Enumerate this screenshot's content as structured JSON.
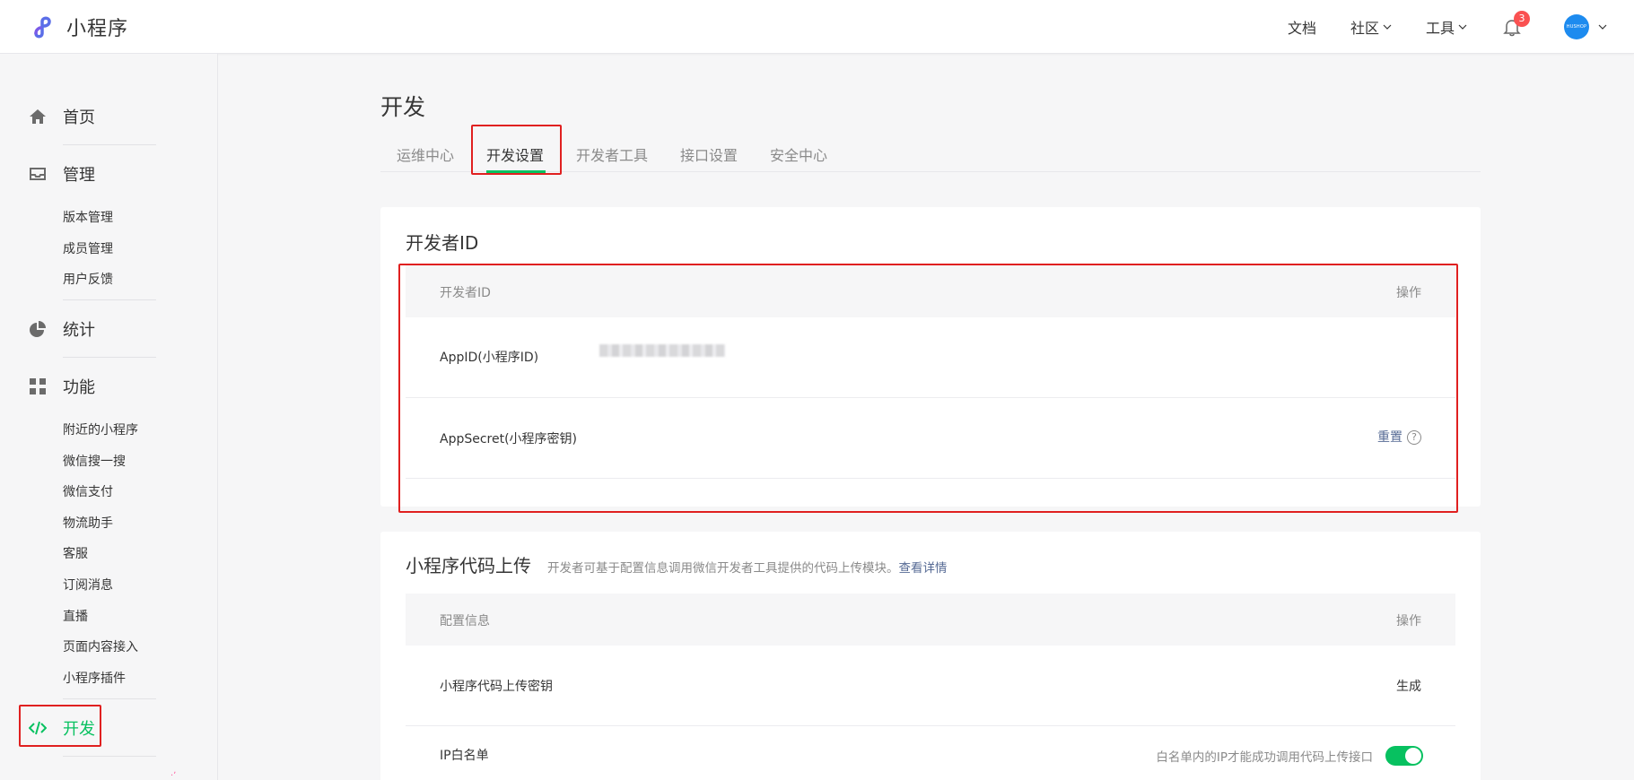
{
  "app": {
    "title": "小程序"
  },
  "topnav": {
    "docs": "文档",
    "community": "社区",
    "tools": "工具",
    "notifications_count": "3",
    "avatar_text": "HUSHOP"
  },
  "sidebar": {
    "home": "首页",
    "manage": "管理",
    "manage_items": [
      "版本管理",
      "成员管理",
      "用户反馈"
    ],
    "stats": "统计",
    "features": "功能",
    "feature_items": [
      "附近的小程序",
      "微信搜一搜",
      "微信支付",
      "物流助手",
      "客服",
      "订阅消息",
      "直播",
      "页面内容接入",
      "小程序插件"
    ],
    "develop": "开发"
  },
  "main": {
    "title": "开发",
    "tabs": [
      "运维中心",
      "开发设置",
      "开发者工具",
      "接口设置",
      "安全中心"
    ],
    "active_tab": "开发设置"
  },
  "dev_id_card": {
    "title": "开发者ID",
    "col_name": "开发者ID",
    "col_action": "操作",
    "appid_label": "AppID(小程序ID)",
    "appsecret_label": "AppSecret(小程序密钥)",
    "reset_label": "重置",
    "help_glyph": "?"
  },
  "upload_card": {
    "title": "小程序代码上传",
    "desc": "开发者可基于配置信息调用微信开发者工具提供的代码上传模块。",
    "desc_link": "查看详情",
    "col_name": "配置信息",
    "col_action": "操作",
    "key_label": "小程序代码上传密钥",
    "key_action": "生成",
    "ip_label": "IP白名单",
    "ip_hint": "白名单内的IP才能成功调用代码上传接口",
    "ip_toggle_on": true
  },
  "colors": {
    "accent": "#07c160",
    "link": "#576b95",
    "highlight_box": "#e02020",
    "badge": "#fa5151"
  }
}
